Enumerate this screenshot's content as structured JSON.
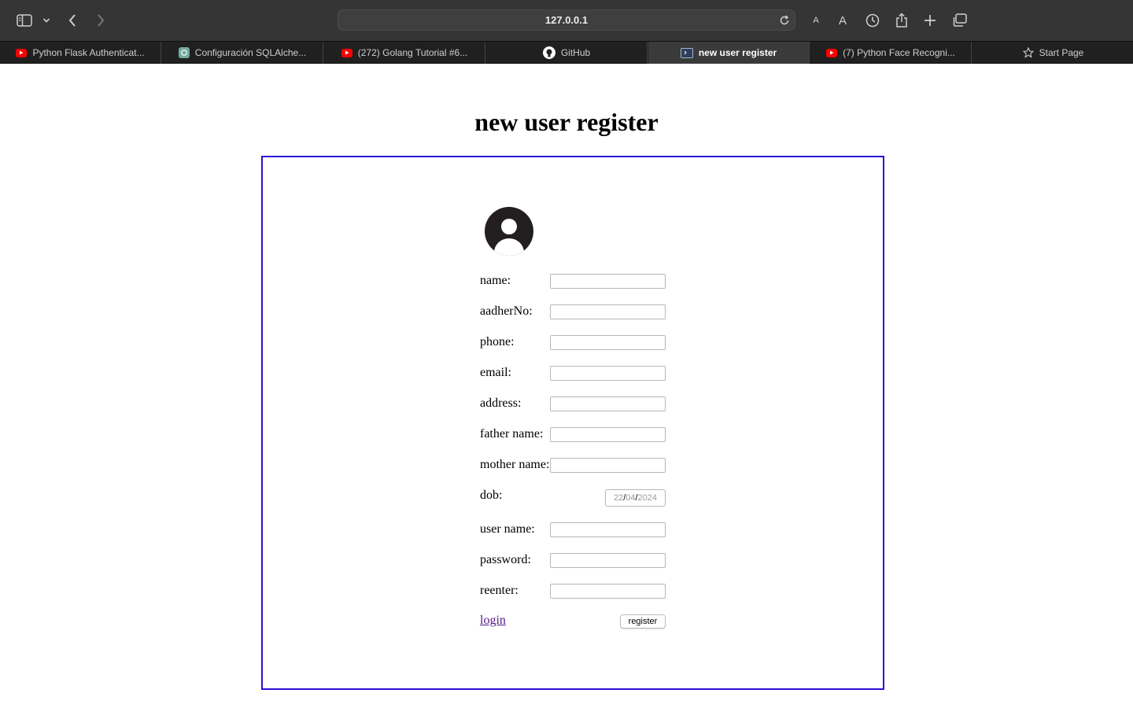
{
  "browser": {
    "address": "127.0.0.1",
    "tabs": [
      {
        "title": "Python Flask Authenticat...",
        "icon": "youtube-icon",
        "active": false
      },
      {
        "title": "Configuración SQLAlche...",
        "icon": "chatgpt-icon",
        "active": false
      },
      {
        "title": "(272) Golang Tutorial #6...",
        "icon": "youtube-icon",
        "active": false
      },
      {
        "title": "GitHub",
        "icon": "github-icon",
        "active": false
      },
      {
        "title": "new user register",
        "icon": "terminal-window-icon",
        "active": true
      },
      {
        "title": "(7) Python Face Recogni...",
        "icon": "youtube-icon",
        "active": false
      },
      {
        "title": "Start Page",
        "icon": "star-icon",
        "active": false
      }
    ],
    "toolbar_icons": [
      "sidebar-icon",
      "chevron-down-icon",
      "back-icon",
      "forward-icon",
      "reload-icon",
      "text-smaller-icon",
      "text-larger-icon",
      "history-icon",
      "share-icon",
      "new-tab-icon",
      "tab-overview-icon"
    ],
    "font_size_small_label": "A",
    "font_size_large_label": "A"
  },
  "page": {
    "heading": "new user register",
    "avatar_icon": "user-avatar-icon",
    "fields": {
      "name": {
        "label": "name:",
        "value": ""
      },
      "aadher": {
        "label": "aadherNo:",
        "value": ""
      },
      "phone": {
        "label": "phone:",
        "value": ""
      },
      "email": {
        "label": "email:",
        "value": ""
      },
      "address": {
        "label": "address:",
        "value": ""
      },
      "father": {
        "label": "father name:",
        "value": ""
      },
      "mother": {
        "label": "mother name:",
        "value": ""
      },
      "dob": {
        "label": "dob:",
        "day": "22",
        "month": "04",
        "year": "2024",
        "separator": "/"
      },
      "username": {
        "label": "user name:",
        "value": ""
      },
      "password": {
        "label": "password:",
        "value": ""
      },
      "reenter": {
        "label": "reenter:",
        "value": ""
      }
    },
    "login_link": "login",
    "register_button": "register"
  },
  "colors": {
    "box_border": "#2a10d6",
    "link_visited": "#551a8b",
    "toolbar_bg": "#353535",
    "tabbar_bg": "#202020",
    "youtube_red": "#ff0000",
    "chatgpt_green": "#74aa9c"
  }
}
